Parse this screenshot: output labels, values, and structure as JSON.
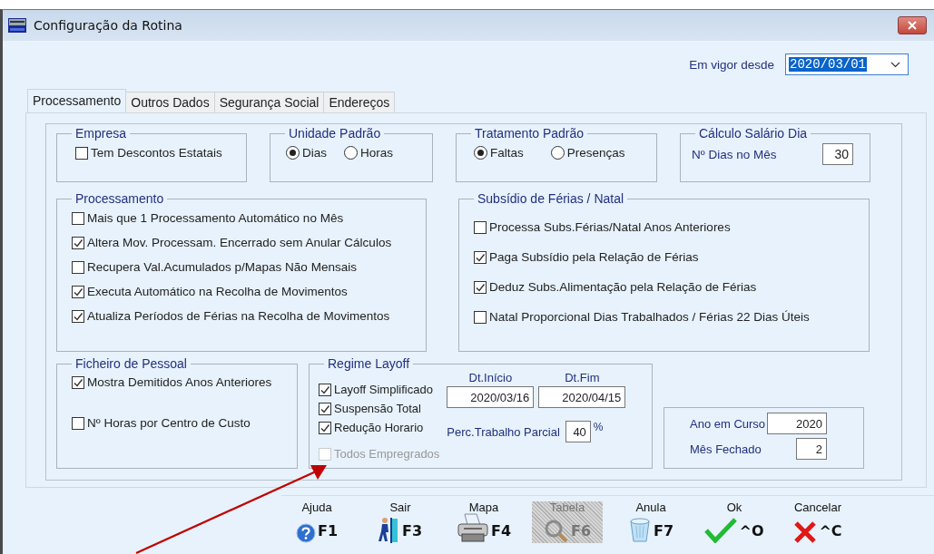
{
  "window": {
    "title": "Configuração da Rotina"
  },
  "effective_date": {
    "label": "Em vigor desde",
    "value": "2020/03/01"
  },
  "tabs": [
    {
      "label": "Processamento",
      "selected": true
    },
    {
      "label": "Outros Dados",
      "selected": false
    },
    {
      "label": "Segurança Social",
      "selected": false
    },
    {
      "label": "Endereços",
      "selected": false
    }
  ],
  "company": {
    "title": "Empresa",
    "options": [
      {
        "label": "Tem Descontos Estatais",
        "checked": false
      }
    ]
  },
  "default_unit": {
    "title": "Unidade Padrão",
    "options": [
      {
        "label": "Dias",
        "selected": true
      },
      {
        "label": "Horas",
        "selected": false
      }
    ]
  },
  "default_treatment": {
    "title": "Tratamento Padrão",
    "options": [
      {
        "label": "Faltas",
        "selected": true
      },
      {
        "label": "Presenças",
        "selected": false
      }
    ]
  },
  "daily_salary": {
    "title": "Cálculo Salário Dia",
    "label": "Nº Dias no Mês",
    "value": "30"
  },
  "processing": {
    "title": "Processamento",
    "options": [
      {
        "label": "Mais que 1 Processamento Automático no Mês",
        "checked": false
      },
      {
        "label": "Altera Mov. Processam. Encerrado sem Anular Cálculos",
        "checked": true
      },
      {
        "label": "Recupera Val.Acumulados  p/Mapas Não Mensais",
        "checked": false
      },
      {
        "label": "Executa Automático na Recolha de Movimentos",
        "checked": true
      },
      {
        "label": "Atualiza Períodos de Férias na Recolha de Movimentos",
        "checked": true
      }
    ]
  },
  "holiday_subsidy": {
    "title": "Subsídio de Férias / Natal",
    "options": [
      {
        "label": "Processa Subs.Férias/Natal Anos Anteriores",
        "checked": false
      },
      {
        "label": "Paga Subsídio pela Relação de Férias",
        "checked": true
      },
      {
        "label": "Deduz Subs.Alimentação pela Relação de Férias",
        "checked": true
      },
      {
        "label": "Natal Proporcional  Dias Trabalhados / Férias 22 Dias Úteis",
        "checked": false
      }
    ]
  },
  "staff_file": {
    "title": "Ficheiro de Pessoal",
    "options": [
      {
        "label": "Mostra Demitidos Anos Anteriores",
        "checked": true
      },
      {
        "label": "Nº Horas por Centro de Custo",
        "checked": false
      }
    ]
  },
  "layoff": {
    "title": "Regime Layoff",
    "options": [
      {
        "label": "Layoff Simplificado",
        "checked": true,
        "disabled": false
      },
      {
        "label": "Suspensão Total",
        "checked": true,
        "disabled": false
      },
      {
        "label": "Redução Horario",
        "checked": true,
        "disabled": false
      },
      {
        "label": "Todos Empregrados",
        "checked": false,
        "disabled": true
      }
    ],
    "start": {
      "label": "Dt.Início",
      "value": "2020/03/16"
    },
    "end": {
      "label": "Dt.Fim",
      "value": "2020/04/15"
    },
    "partial": {
      "label": "Perc.Trabalho Parcial",
      "value": "40",
      "unit": "%"
    }
  },
  "period": {
    "fields": [
      {
        "label": "Ano em Curso",
        "value": "2020"
      },
      {
        "label": "Mês Fechado",
        "value": "2"
      }
    ]
  },
  "toolbar": [
    {
      "label": "Ajuda",
      "key": "F1",
      "kind": "help",
      "disabled": false
    },
    {
      "label": "Sair",
      "key": "F3",
      "kind": "exit",
      "disabled": false
    },
    {
      "label": "Mapa",
      "key": "F4",
      "kind": "print",
      "disabled": false
    },
    {
      "label": "Tabela",
      "key": "F6",
      "kind": "search",
      "disabled": true
    },
    {
      "label": "Anula",
      "key": "F7",
      "kind": "trash",
      "disabled": false
    },
    {
      "label": "Ok",
      "key": "^O",
      "kind": "ok",
      "disabled": false
    },
    {
      "label": "Cancelar",
      "key": "^C",
      "kind": "cancel",
      "disabled": false
    }
  ]
}
